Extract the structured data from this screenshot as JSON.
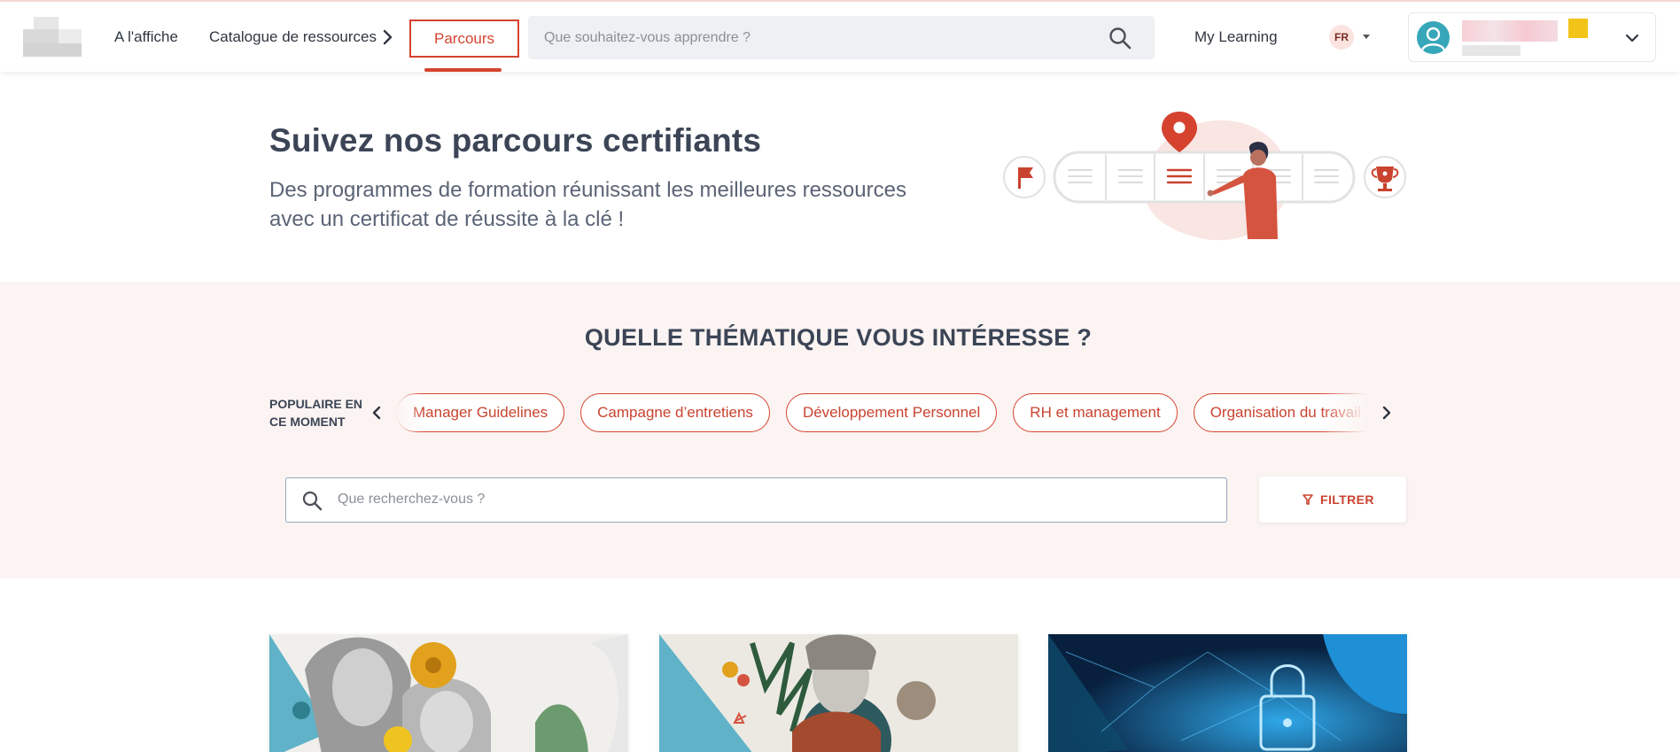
{
  "header": {
    "nav": {
      "a_l_affiche": "A l'affiche",
      "catalogue": "Catalogue de ressources",
      "parcours": "Parcours"
    },
    "search": {
      "placeholder": "Que souhaitez-vous apprendre ?"
    },
    "my_learning": "My Learning",
    "language": "FR"
  },
  "hero": {
    "title": "Suivez nos parcours certifiants",
    "subtitle_line1": "Des programmes de formation réunissant les meilleures ressources",
    "subtitle_line2": "avec un certificat de réussite à la clé !"
  },
  "themes": {
    "title": "QUELLE THÉMATIQUE VOUS INTÉRESSE ?",
    "popular_label_line1": "POPULAIRE EN",
    "popular_label_line2": "CE MOMENT",
    "chips": [
      "Manager Guidelines",
      "Campagne d’entretiens",
      "Développement Personnel",
      "RH et management",
      "Organisation du travail"
    ],
    "search_placeholder": "Que recherchez-vous ?",
    "filter_label": "FILTRER"
  },
  "colors": {
    "accent": "#d5432f",
    "band_background": "#fbf4f2",
    "heading": "#3c4556",
    "avatar": "#36a7b9"
  },
  "icons": {
    "search": "search-icon",
    "chevron_right": "chevron-right-icon",
    "chevron_left": "chevron-left-icon",
    "chevron_down": "chevron-down-icon",
    "filter": "filter-icon",
    "flag": "flag-icon",
    "trophy": "trophy-icon",
    "location_pin": "location-pin-icon"
  }
}
